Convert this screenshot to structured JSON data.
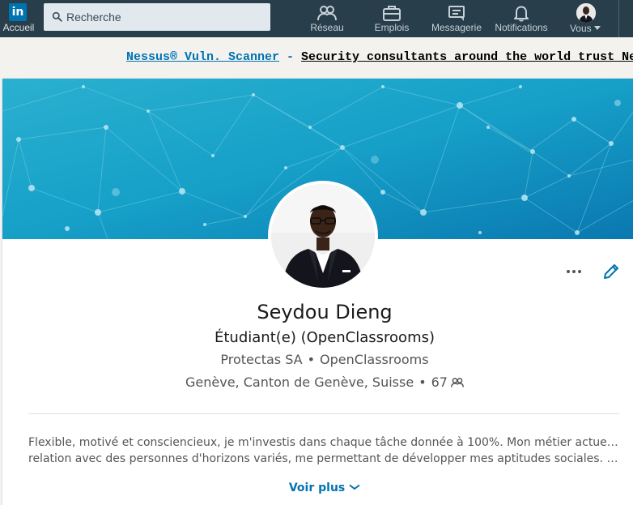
{
  "nav": {
    "logo_text": "in",
    "home_label": "Accueil",
    "search_placeholder": "Recherche",
    "items": [
      {
        "label": "Réseau",
        "icon": "network-icon"
      },
      {
        "label": "Emplois",
        "icon": "briefcase-icon"
      },
      {
        "label": "Messagerie",
        "icon": "messaging-icon"
      },
      {
        "label": "Notifications",
        "icon": "bell-icon"
      }
    ],
    "me_label": "Vous"
  },
  "ad": {
    "brand": "Nessus® Vuln. Scanner",
    "separator": " - ",
    "message": "Security consultants around the world trust Nessus"
  },
  "profile": {
    "name": "Seydou Dieng",
    "headline": "Étudiant(e) (OpenClassrooms)",
    "companies": [
      "Protectas SA",
      "OpenClassrooms"
    ],
    "location": "Genève, Canton de Genève, Suisse",
    "connections": "67",
    "summary_line1": "Flexible, motivé et consciencieux, je m'investis dans chaque tâche donnée à 100%. Mon métier actuel m'a mis en",
    "summary_line2": "relation avec des personnes d'horizons variés, me permettant de développer mes aptitudes sociales. Ayant travaill…",
    "see_more": "Voir plus"
  },
  "colors": {
    "nav_bg": "#283e4a",
    "brand": "#0073b1",
    "cover_left": "#1d9fc4",
    "cover_right": "#0d7fb3"
  },
  "separator_dot": "•"
}
